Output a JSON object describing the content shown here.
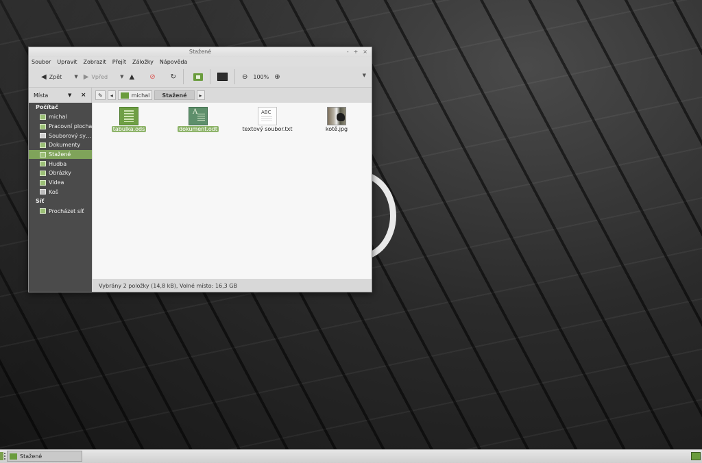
{
  "window": {
    "title": "Stažené",
    "controls": {
      "minimize": "-",
      "maximize": "+",
      "close": "×"
    }
  },
  "menubar": [
    "Soubor",
    "Upravit",
    "Zobrazit",
    "Přejít",
    "Záložky",
    "Nápověda"
  ],
  "toolbar": {
    "back_label": "Zpět",
    "forward_label": "Vpřed",
    "zoom": "100%",
    "icons": {
      "back": "arrow-left-icon",
      "forward": "arrow-right-icon",
      "up": "arrow-up-icon",
      "stop": "stop-icon",
      "reload": "reload-icon",
      "home": "home-folder-icon",
      "terminal": "computer-icon",
      "zoom_out": "zoom-out-icon",
      "zoom_in": "zoom-in-icon"
    }
  },
  "sidebar": {
    "header_label": "Místa",
    "groups": [
      {
        "label": "Počítač",
        "items": [
          {
            "label": "michal",
            "active": false
          },
          {
            "label": "Pracovní plocha",
            "active": false
          },
          {
            "label": "Souborový sy…",
            "active": false
          },
          {
            "label": "Dokumenty",
            "active": false
          },
          {
            "label": "Stažené",
            "active": true
          },
          {
            "label": "Hudba",
            "active": false
          },
          {
            "label": "Obrázky",
            "active": false
          },
          {
            "label": "Videa",
            "active": false
          },
          {
            "label": "Koš",
            "active": false
          }
        ]
      },
      {
        "label": "Síť",
        "items": [
          {
            "label": "Procházet síť",
            "active": false
          }
        ]
      }
    ]
  },
  "pathbar": {
    "parent": "michal",
    "current": "Stažené"
  },
  "files": [
    {
      "name": "tabulka.ods",
      "type": "spreadsheet",
      "selected": true
    },
    {
      "name": "dokument.odt",
      "type": "document",
      "selected": true
    },
    {
      "name": "textový soubor.txt",
      "type": "text",
      "icon_text": "ABC",
      "selected": false
    },
    {
      "name": "kotě.jpg",
      "type": "image",
      "selected": false
    }
  ],
  "statusbar": {
    "text": "Vybrány 2 položky (14,8 kB), Volné místo: 16,3 GB"
  },
  "taskbar": {
    "task_label": "Stažené"
  },
  "colors": {
    "accent": "#7fa35a",
    "sidebar_bg": "#4b4b4b",
    "window_bg": "#d9d9d9"
  }
}
